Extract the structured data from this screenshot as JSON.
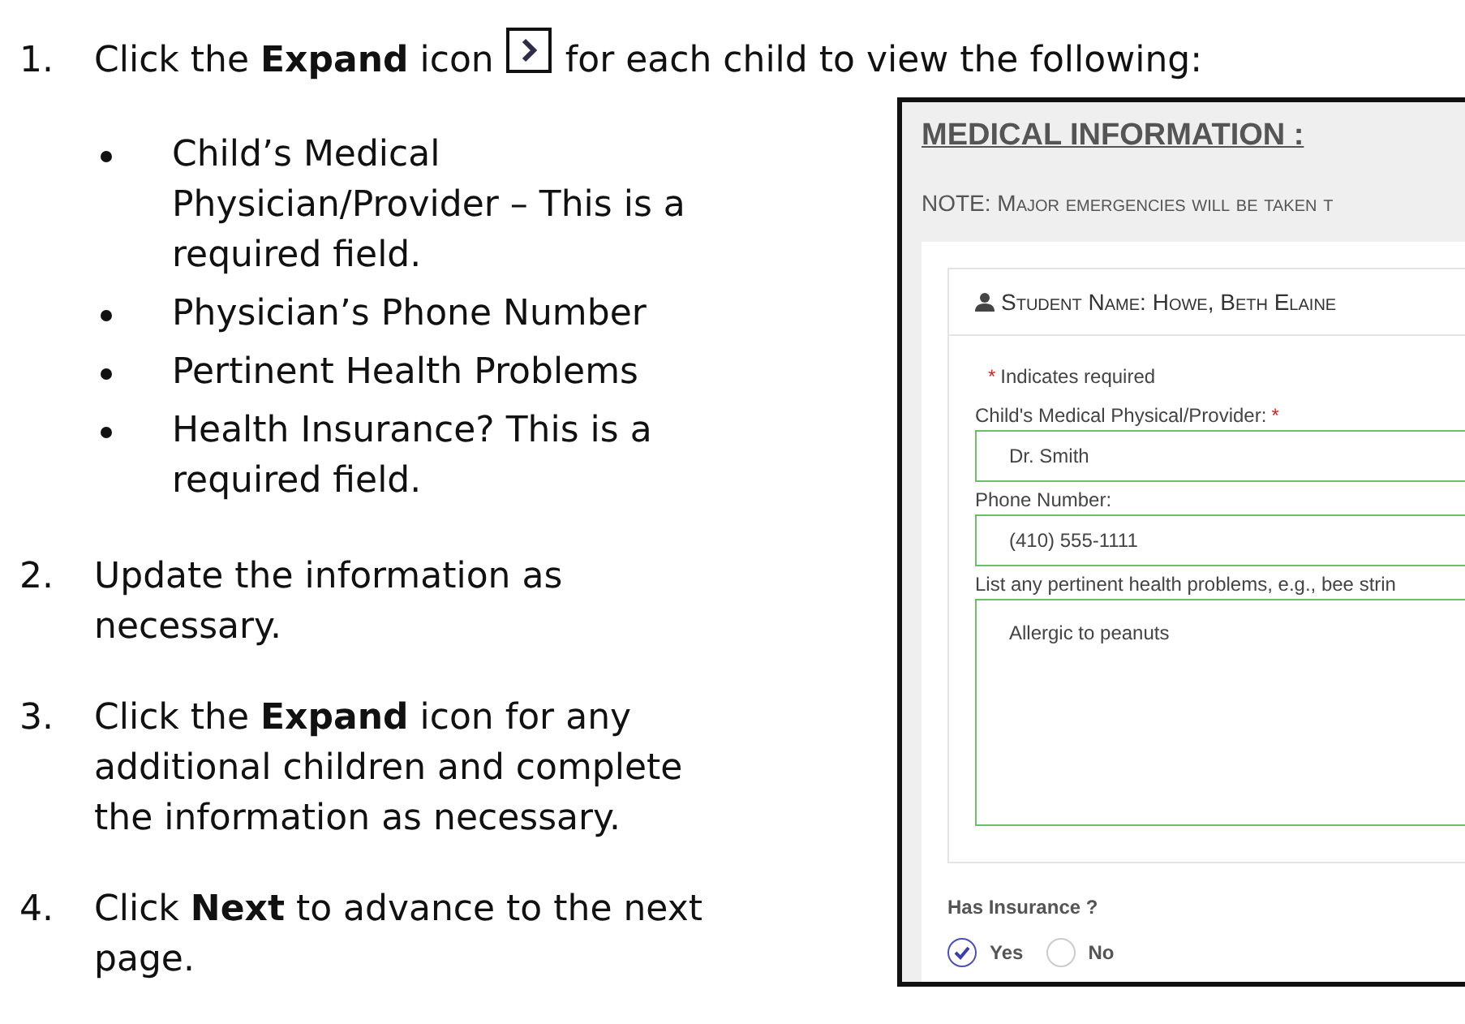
{
  "steps": [
    {
      "number": "1.",
      "text": "Click the **Expand** icon",
      "text_after": "for each child to view the following:",
      "bullets": [
        {
          "text": "Child’s Medical Physician/Provider – This is a required field."
        },
        {
          "text": "Physician’s Phone Number"
        },
        {
          "text": "Pertinent Health Problems"
        },
        {
          "text": "Health Insurance? This is a required field."
        }
      ]
    },
    {
      "number": "2.",
      "text": "Update the information as necessary."
    },
    {
      "number": "3.",
      "text": "Click the **Expand** icon for any additional children and complete the information as necessary."
    },
    {
      "number": "4.",
      "text": "Click **Next** to advance to the next page."
    }
  ],
  "screenshot": {
    "heading": "MEDICAL INFORMATION :",
    "note": "NOTE: Major emergencies will be taken t",
    "student_name": "Student Name: Howe, Beth Elaine",
    "required_mark": "*",
    "required_note": "Indicates required",
    "fields": [
      {
        "kind": "input",
        "label": "Child's Medical Physical/Provider:",
        "required": true,
        "value": "Dr. Smith"
      },
      {
        "kind": "input",
        "label": "Phone Number:",
        "required": false,
        "value": "(410) 555-1111"
      },
      {
        "kind": "textarea",
        "label": "List any pertinent health problems, e.g., bee strin",
        "required": false,
        "value": "Allergic to peanuts"
      }
    ],
    "question": "Has Insurance ?",
    "options": [
      {
        "label": "Yes",
        "selected": true
      },
      {
        "label": "No",
        "selected": false
      }
    ]
  }
}
